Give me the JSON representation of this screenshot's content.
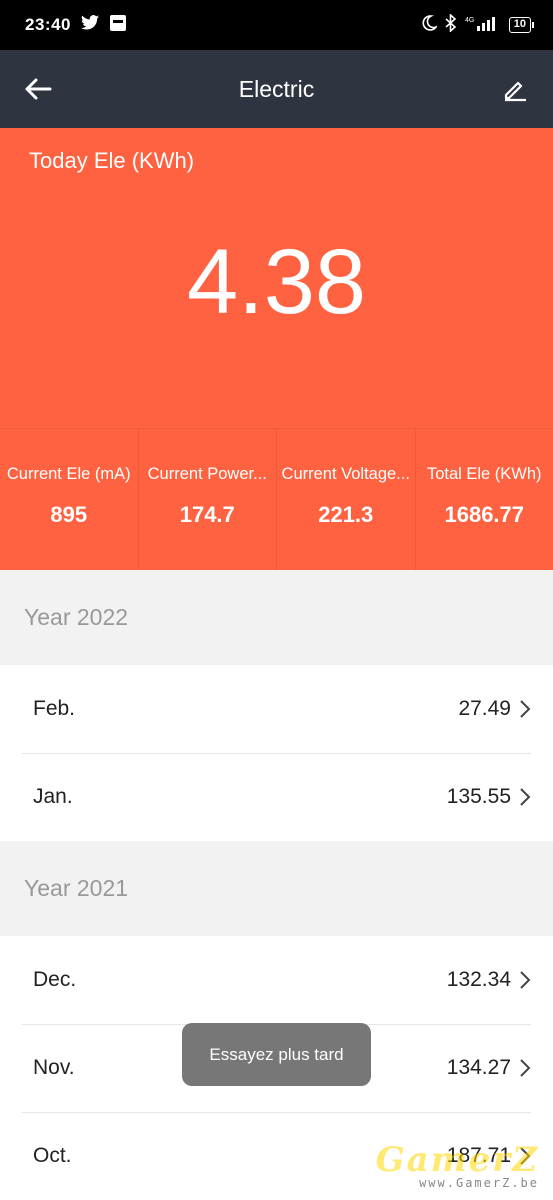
{
  "status_bar": {
    "time": "23:40",
    "battery": "10"
  },
  "header": {
    "title": "Electric"
  },
  "today": {
    "label": "Today Ele (KWh)",
    "value": "4.38"
  },
  "stats": [
    {
      "label": "Current Ele (mA)",
      "value": "895"
    },
    {
      "label": "Current Power...",
      "value": "174.7"
    },
    {
      "label": "Current Voltage...",
      "value": "221.3"
    },
    {
      "label": "Total Ele (KWh)",
      "value": "1686.77"
    }
  ],
  "history": {
    "year_2022": {
      "title": "Year 2022",
      "rows": [
        {
          "month": "Feb.",
          "value": "27.49"
        },
        {
          "month": "Jan.",
          "value": "135.55"
        }
      ]
    },
    "year_2021": {
      "title": "Year 2021",
      "rows": [
        {
          "month": "Dec.",
          "value": "132.34"
        },
        {
          "month": "Nov.",
          "value": "134.27"
        },
        {
          "month": "Oct.",
          "value": "187.71"
        }
      ]
    }
  },
  "toast": {
    "message": "Essayez plus tard"
  },
  "watermark": {
    "brand": "GamerZ",
    "site": "www.GamerZ.be"
  },
  "colors": {
    "accent": "#ff6240",
    "toolbar": "#2e3440",
    "toast": "#777777"
  },
  "icons": [
    "twitter-icon",
    "sim-icon",
    "moon-icon",
    "bluetooth-icon",
    "signal-icon",
    "back-arrow-icon",
    "edit-pencil-icon",
    "chevron-right-icon"
  ]
}
